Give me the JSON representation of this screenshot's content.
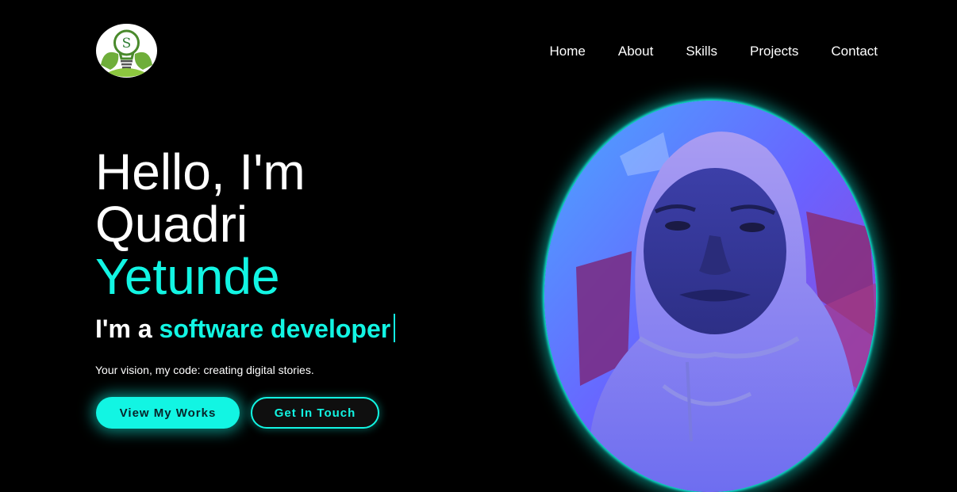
{
  "logo": {
    "letter": "S",
    "icon": "lightbulb-icon"
  },
  "nav": {
    "items": [
      {
        "label": "Home"
      },
      {
        "label": "About"
      },
      {
        "label": "Skills"
      },
      {
        "label": "Projects"
      },
      {
        "label": "Contact"
      }
    ]
  },
  "hero": {
    "greeting": "Hello, I'm",
    "first_name": "Quadri",
    "last_name": "Yetunde",
    "role_prefix": "I'm a",
    "role_title": "software developer",
    "tagline": "Your vision, my code: creating digital stories."
  },
  "buttons": {
    "primary_label": "View My Works",
    "secondary_label": "Get In Touch"
  },
  "colors": {
    "accent": "#12f5e3",
    "background": "#000000",
    "text": "#ffffff"
  },
  "portrait": {
    "subject": "profile-photo"
  }
}
